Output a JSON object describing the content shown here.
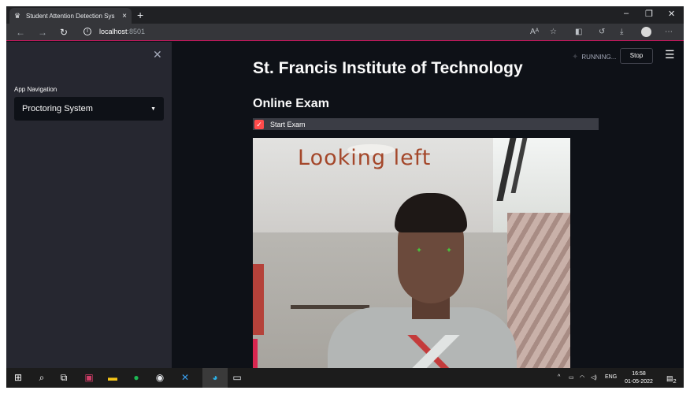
{
  "browser": {
    "tab_title": "Student Attention Detection Sys",
    "tab_icon": "streamlit-crown-icon",
    "url_host": "localhost",
    "url_port": ":8501"
  },
  "sidebar": {
    "nav_label": "App Navigation",
    "selected_page": "Proctoring System"
  },
  "header": {
    "status": "RUNNING...",
    "stop_label": "Stop"
  },
  "main": {
    "title": "St. Francis Institute of Technology",
    "section_title": "Online Exam",
    "checkbox_label": "Start Exam",
    "checkbox_checked": true,
    "camera_overlay": "Looking left"
  },
  "taskbar": {
    "lang": "ENG",
    "time": "16:58",
    "date": "01-05-2022",
    "notification_count": "2"
  },
  "colors": {
    "accent": "#ff4b4b",
    "app_bg": "#0e1117",
    "sidebar_bg": "#262730",
    "overlay_text": "#a4472a",
    "landmark": "#3cf03c"
  }
}
